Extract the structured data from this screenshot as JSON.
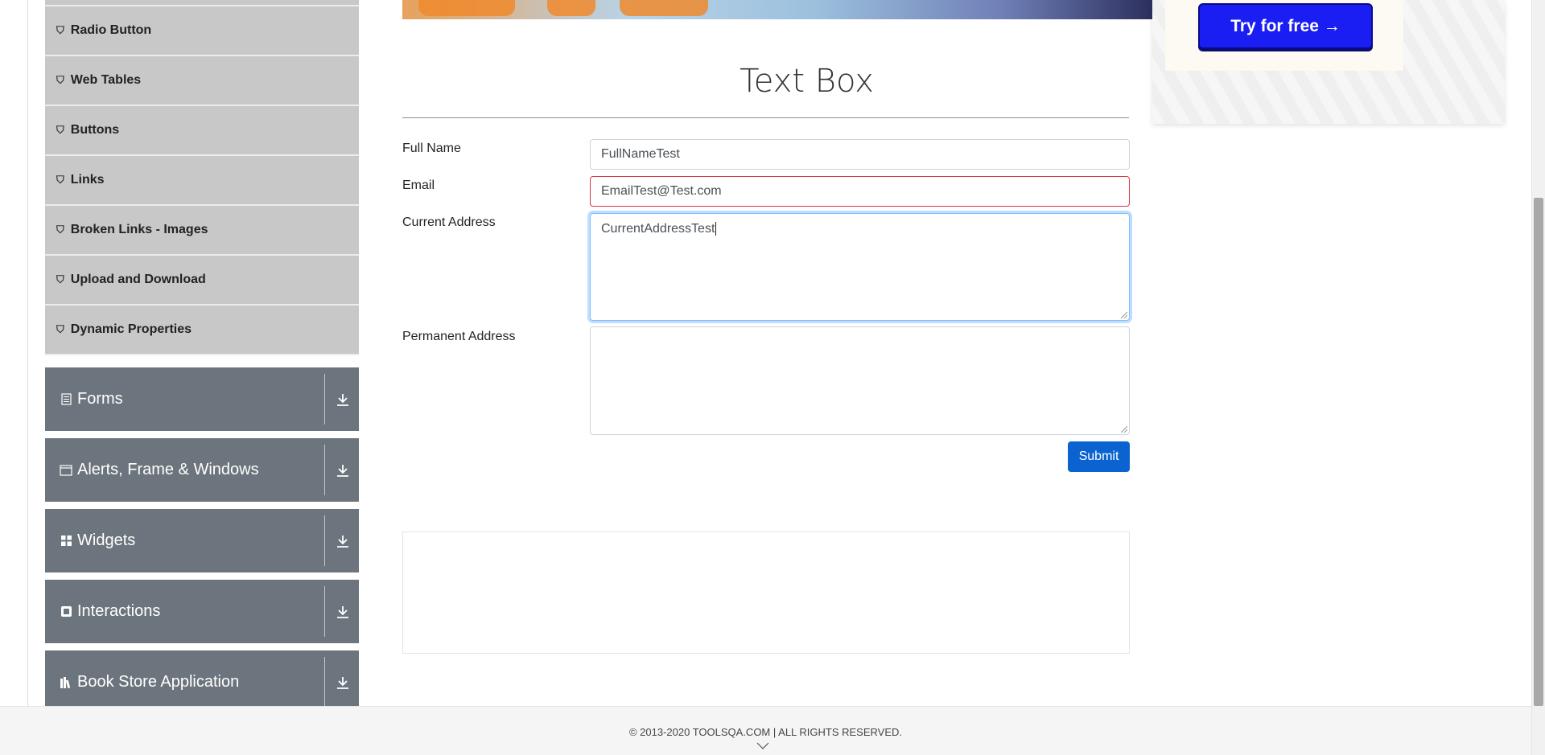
{
  "sidebar": {
    "sub_items": [
      {
        "label": "Radio Button",
        "icon": "html5-icon"
      },
      {
        "label": "Web Tables",
        "icon": "html5-icon"
      },
      {
        "label": "Buttons",
        "icon": "html5-icon"
      },
      {
        "label": "Links",
        "icon": "html5-icon"
      },
      {
        "label": "Broken Links - Images",
        "icon": "html5-icon"
      },
      {
        "label": "Upload and Download",
        "icon": "html5-icon"
      },
      {
        "label": "Dynamic Properties",
        "icon": "html5-icon"
      }
    ],
    "groups": [
      {
        "label": "Forms",
        "icon": "form-icon"
      },
      {
        "label": "Alerts, Frame & Windows",
        "icon": "window-icon"
      },
      {
        "label": "Widgets",
        "icon": "widgets-icon"
      },
      {
        "label": "Interactions",
        "icon": "interactions-icon"
      },
      {
        "label": "Book Store Application",
        "icon": "book-icon"
      }
    ]
  },
  "main": {
    "title": "Text Box",
    "form": {
      "full_name": {
        "label": "Full Name",
        "value": "FullNameTest"
      },
      "email": {
        "label": "Email",
        "value": "EmailTest@Test.com"
      },
      "current_address": {
        "label": "Current Address",
        "value": "CurrentAddressTest"
      },
      "permanent_address": {
        "label": "Permanent Address",
        "value": ""
      },
      "submit_label": "Submit"
    }
  },
  "ad": {
    "button_label": "Try for free →"
  },
  "footer": {
    "copyright": "© 2013-2020 TOOLSQA.COM | ALL RIGHTS RESERVED."
  },
  "colors": {
    "submit": "#0b63d1",
    "error_border": "#dc3545",
    "group_header": "#6c757d",
    "ad_button": "#1a1ef2"
  }
}
